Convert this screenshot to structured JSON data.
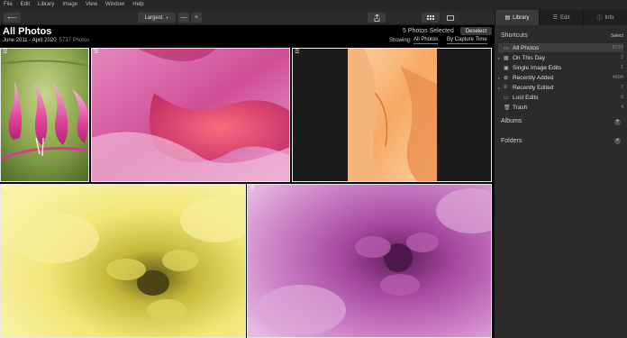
{
  "menubar": {
    "items": [
      "File",
      "Edit",
      "Library",
      "Image",
      "View",
      "Window",
      "Help"
    ]
  },
  "toolbar": {
    "back_icon": "arrow-left-icon",
    "zoom_value": "Largest",
    "zoom_out": "—",
    "zoom_in": "+",
    "share_icon": "share-icon",
    "grid_view_icon": "grid-icon",
    "single_view_icon": "single-view-icon"
  },
  "right_tabs": [
    {
      "label": "Library",
      "icon": "library-icon",
      "active": true
    },
    {
      "label": "Edit",
      "icon": "edit-icon",
      "active": false
    },
    {
      "label": "Info",
      "icon": "info-icon",
      "active": false
    }
  ],
  "header": {
    "title": "All Photos",
    "date_range": "June 2011 - April 2020",
    "photo_count": "5737 Photos",
    "selected_text": "5 Photos Selected",
    "deselect_label": "Deselect",
    "showing_label": "Showing:",
    "filter_value": "All Photos",
    "sort_value": "By Capture Time"
  },
  "photos": [
    {
      "subject": "pink bleeding heart flowers",
      "selected": true,
      "colors": [
        "#6f8e3b",
        "#c0d17a",
        "#e04a9c"
      ]
    },
    {
      "subject": "pink petal macro",
      "selected": true,
      "colors": [
        "#d04c8a",
        "#ef9ac8",
        "#ff5e6e"
      ]
    },
    {
      "subject": "orange flower petals",
      "selected": true,
      "colors": [
        "#fbc28a",
        "#e08040",
        "#1c1c1c"
      ]
    },
    {
      "subject": "yellow dahlia",
      "selected": true,
      "colors": [
        "#f2ea78",
        "#cfc03c",
        "#6d6420"
      ]
    },
    {
      "subject": "purple dahlia",
      "selected": true,
      "colors": [
        "#c06ab8",
        "#7a2e72",
        "#e4a6de"
      ]
    }
  ],
  "sidebar": {
    "shortcuts_label": "Shortcuts",
    "select_link": "Select",
    "items": [
      {
        "label": "All Photos",
        "count": "5737",
        "icon": "photos-icon",
        "active": true
      },
      {
        "label": "On This Day",
        "count": "2",
        "icon": "calendar-icon",
        "active": false
      },
      {
        "label": "Single Image Edits",
        "count": "1",
        "icon": "single-image-icon",
        "active": false
      },
      {
        "label": "Recently Added",
        "count": "4804",
        "icon": "plus-circle-icon",
        "active": false
      },
      {
        "label": "Recently Edited",
        "count": "7",
        "icon": "sliders-icon",
        "active": false
      },
      {
        "label": "Lost Edits",
        "count": "0",
        "icon": "folder-icon",
        "active": false
      },
      {
        "label": "Trash",
        "count": "4",
        "icon": "trash-icon",
        "active": false
      }
    ],
    "albums_label": "Albums",
    "folders_label": "Folders",
    "add_symbol": "+"
  },
  "colors": {
    "selection_outline": "#e8e8e8",
    "sidebar_bg": "#2b2b2b",
    "header_bg": "#000000"
  }
}
